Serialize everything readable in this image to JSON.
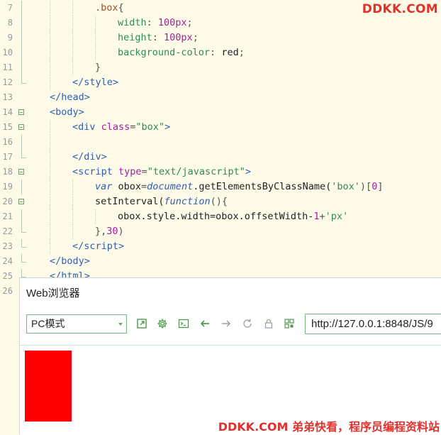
{
  "watermark": {
    "top": "DDKK.COM",
    "bottom": "DDKK.COM 弟弟快看，程序员编程资料站"
  },
  "editor": {
    "lines": [
      {
        "num": "7",
        "fold": "bar",
        "indent": 2,
        "tokens": [
          {
            "t": ".box",
            "c": "sel"
          },
          {
            "t": "{",
            "c": "punct"
          }
        ]
      },
      {
        "num": "8",
        "fold": "bar",
        "indent": 3,
        "tokens": [
          {
            "t": "width",
            "c": "prop"
          },
          {
            "t": ": ",
            "c": "punct"
          },
          {
            "t": "100px",
            "c": "num"
          },
          {
            "t": ";",
            "c": "punct"
          }
        ]
      },
      {
        "num": "9",
        "fold": "bar",
        "indent": 3,
        "tokens": [
          {
            "t": "height",
            "c": "prop"
          },
          {
            "t": ": ",
            "c": "punct"
          },
          {
            "t": "100px",
            "c": "num"
          },
          {
            "t": ";",
            "c": "punct"
          }
        ]
      },
      {
        "num": "10",
        "fold": "bar",
        "indent": 3,
        "tokens": [
          {
            "t": "background-color",
            "c": "prop"
          },
          {
            "t": ": ",
            "c": "punct"
          },
          {
            "t": "red",
            "c": "val"
          },
          {
            "t": ";",
            "c": "punct"
          }
        ]
      },
      {
        "num": "11",
        "fold": "bar",
        "indent": 2,
        "tokens": [
          {
            "t": "}",
            "c": "punct"
          }
        ]
      },
      {
        "num": "12",
        "fold": "end",
        "indent": 1,
        "tokens": [
          {
            "t": "</style>",
            "c": "tag"
          }
        ]
      },
      {
        "num": "13",
        "fold": "none",
        "indent": 0,
        "tokens": [
          {
            "t": "</head>",
            "c": "tag"
          }
        ]
      },
      {
        "num": "14",
        "fold": "open",
        "indent": 0,
        "tokens": [
          {
            "t": "<body>",
            "c": "tag"
          }
        ]
      },
      {
        "num": "15",
        "fold": "open",
        "indent": 1,
        "tokens": [
          {
            "t": "<div ",
            "c": "tag"
          },
          {
            "t": "class",
            "c": "attr"
          },
          {
            "t": "=",
            "c": "punct"
          },
          {
            "t": "\"box\"",
            "c": "str"
          },
          {
            "t": ">",
            "c": "tag"
          }
        ]
      },
      {
        "num": "16",
        "fold": "bar",
        "indent": 1,
        "tokens": []
      },
      {
        "num": "17",
        "fold": "end",
        "indent": 1,
        "tokens": [
          {
            "t": "</div>",
            "c": "tag"
          }
        ]
      },
      {
        "num": "18",
        "fold": "open",
        "indent": 1,
        "tokens": [
          {
            "t": "<script ",
            "c": "tag"
          },
          {
            "t": "type",
            "c": "attr"
          },
          {
            "t": "=",
            "c": "punct"
          },
          {
            "t": "\"text/javascript\"",
            "c": "str"
          },
          {
            "t": ">",
            "c": "tag"
          }
        ]
      },
      {
        "num": "19",
        "fold": "bar",
        "indent": 2,
        "tokens": [
          {
            "t": "var ",
            "c": "kw"
          },
          {
            "t": "obox",
            "c": "id"
          },
          {
            "t": "=",
            "c": "punct"
          },
          {
            "t": "document",
            "c": "obj"
          },
          {
            "t": ".getElementsByClassName(",
            "c": "fn"
          },
          {
            "t": "'box'",
            "c": "str"
          },
          {
            "t": ")[",
            "c": "punct"
          },
          {
            "t": "0",
            "c": "num"
          },
          {
            "t": "]",
            "c": "punct"
          }
        ]
      },
      {
        "num": "20",
        "fold": "open",
        "indent": 2,
        "tokens": [
          {
            "t": "setInterval(",
            "c": "fn"
          },
          {
            "t": "function",
            "c": "kw"
          },
          {
            "t": "(){",
            "c": "punct"
          }
        ]
      },
      {
        "num": "21",
        "fold": "bar",
        "indent": 3,
        "tokens": [
          {
            "t": "obox.style.width=obox.offsetWidth-",
            "c": "id"
          },
          {
            "t": "1",
            "c": "num"
          },
          {
            "t": "+",
            "c": "punct"
          },
          {
            "t": "'px'",
            "c": "str"
          }
        ]
      },
      {
        "num": "22",
        "fold": "end",
        "indent": 2,
        "tokens": [
          {
            "t": "},",
            "c": "punct"
          },
          {
            "t": "30",
            "c": "num"
          },
          {
            "t": ")",
            "c": "punct"
          }
        ]
      },
      {
        "num": "23",
        "fold": "end",
        "indent": 1,
        "tokens": [
          {
            "t": "</",
            "c": "tag"
          },
          {
            "t": "script",
            "c": "tag"
          },
          {
            "t": ">",
            "c": "tag"
          }
        ]
      },
      {
        "num": "24",
        "fold": "end",
        "indent": 0,
        "tokens": [
          {
            "t": "</body>",
            "c": "tag"
          }
        ]
      },
      {
        "num": "25",
        "fold": "end",
        "indent": 0,
        "tokens": [
          {
            "t": "</html>",
            "c": "tag"
          }
        ]
      },
      {
        "num": "26",
        "fold": "none",
        "indent": 0,
        "tokens": []
      }
    ]
  },
  "browser": {
    "title": "Web浏览器",
    "mode": "PC模式",
    "url": "http://127.0.0.1:8848/JS/9",
    "icons": [
      "open-external-icon",
      "settings-gear-icon",
      "console-icon",
      "back-arrow-icon",
      "forward-arrow-icon",
      "refresh-icon",
      "lock-icon",
      "qr-code-icon"
    ],
    "accent": "#4a9a4a",
    "box_color": "#ff0000"
  }
}
